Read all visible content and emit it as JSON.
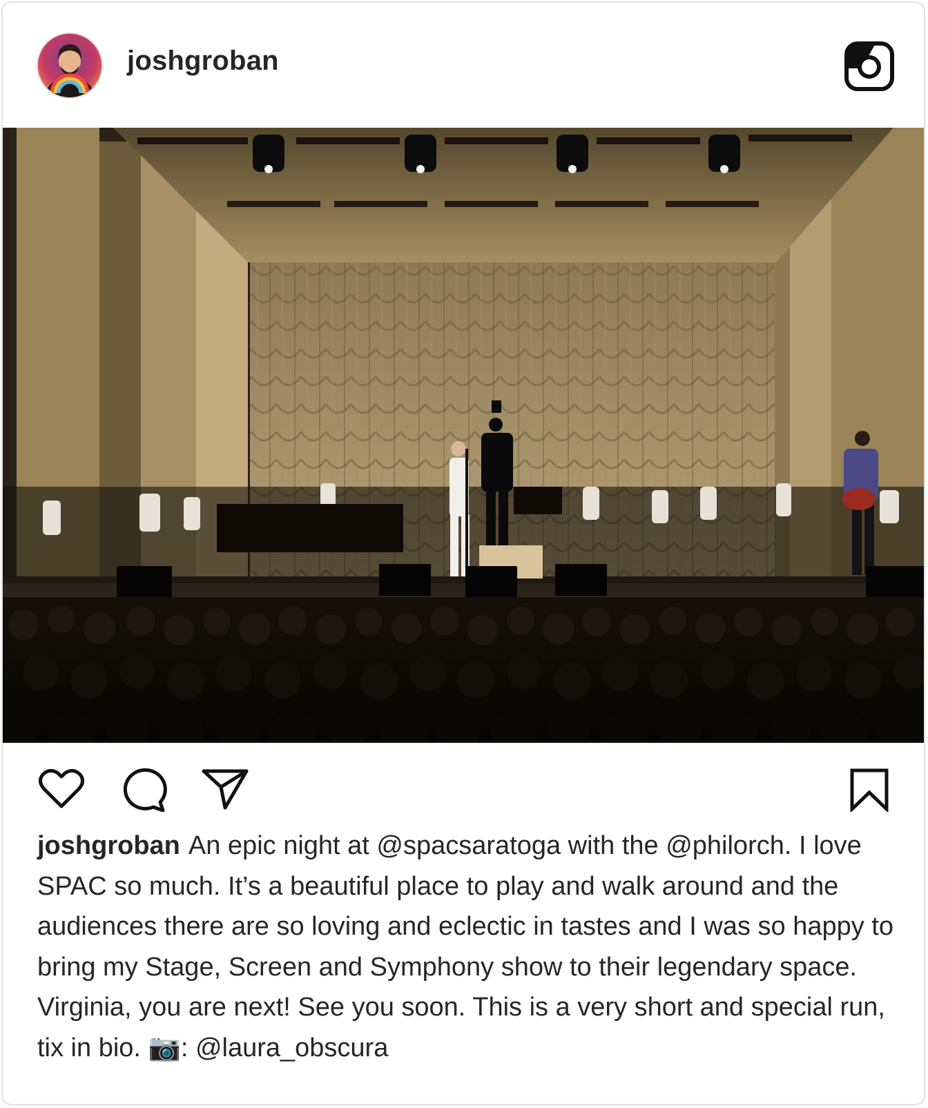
{
  "post": {
    "username": "joshgroban",
    "caption_user": "joshgroban",
    "caption_text": "An epic night at @spacsaratoga with the @philorch. I love SPAC so much. It’s a beautiful place to play and walk around and the audiences there are so loving and eclectic in tastes and I was so happy to bring my Stage, Screen and Symphony show to their legendary space. Virginia, you are next! See you soon. This is a very short and special run, tix in bio. 📷: @laura_obscura"
  },
  "icons": {
    "header": "instagram-logo-icon",
    "actions": [
      "heart-icon",
      "comment-icon",
      "share-icon",
      "bookmark-icon"
    ]
  },
  "colors": {
    "text": "#262626",
    "border": "#e2e2e2",
    "stage_wall": "#b59f72",
    "stage_dark": "#0d0b07"
  }
}
